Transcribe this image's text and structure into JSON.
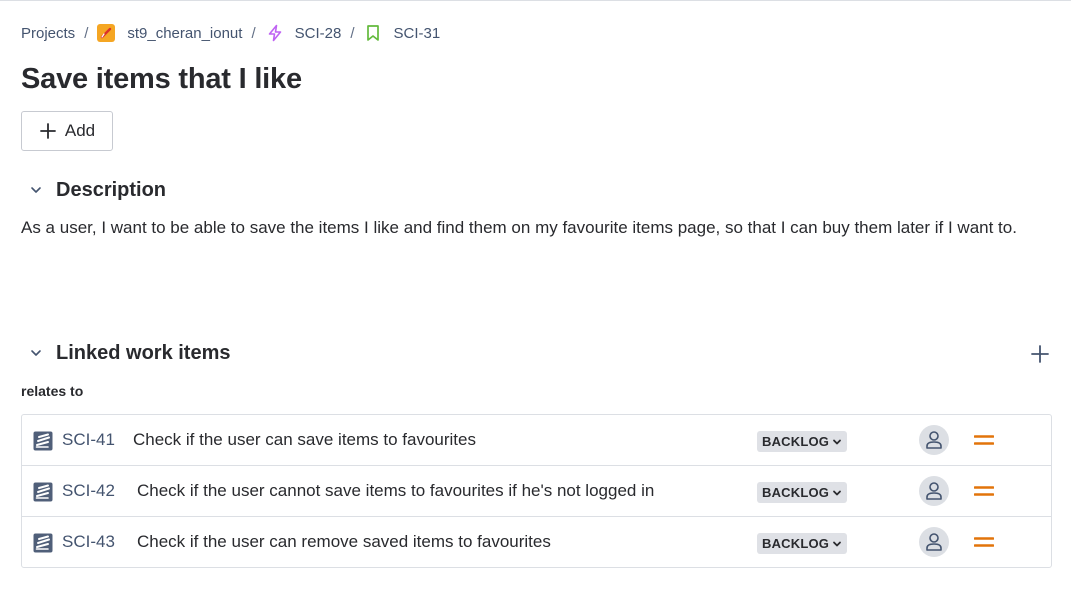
{
  "breadcrumb": {
    "root": "Projects",
    "project": "st9_cheran_ionut",
    "epic": "SCI-28",
    "issue": "SCI-31",
    "separator": "/"
  },
  "title": "Save items that I like",
  "add_button": {
    "label": "Add",
    "icon": "plus-icon"
  },
  "description": {
    "heading": "Description",
    "text": "As a user, I want to be able to save the items I like and find them on my favourite items page, so that I can buy them later if I want to."
  },
  "linked": {
    "heading": "Linked work items",
    "relation": "relates to",
    "items": [
      {
        "key": "SCI-41",
        "summary": "Check if the user can save items to favourites",
        "status": "BACKLOG"
      },
      {
        "key": "SCI-42",
        "summary": "Check if the user cannot save items to favourites if he's not logged in",
        "status": "BACKLOG"
      },
      {
        "key": "SCI-43",
        "summary": "Check if the user can remove saved items to favourites",
        "status": "BACKLOG"
      }
    ]
  },
  "colors": {
    "epic": "#bf63f3",
    "story": "#63ba3c",
    "project": "#f5a623",
    "priority_medium": "#e2740a"
  }
}
